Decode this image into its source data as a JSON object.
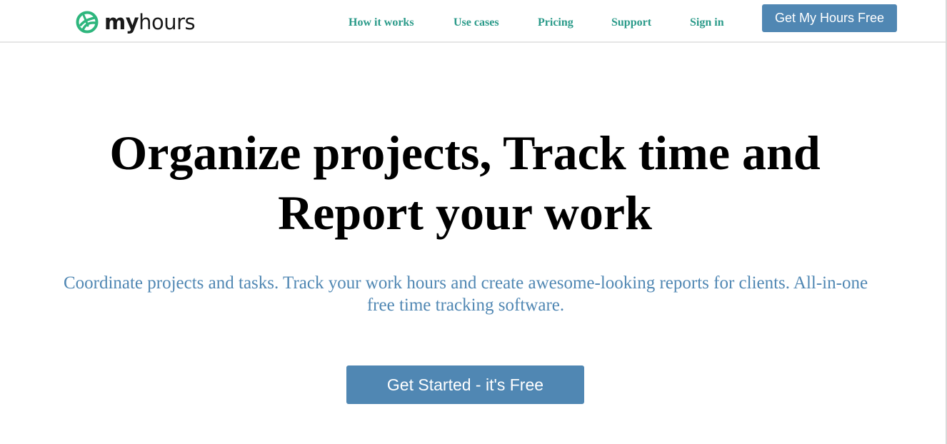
{
  "brand": {
    "name_bold": "my",
    "name_light": "hours",
    "logo_icon": "globe-swirl-icon",
    "accent_color": "#2eb67d"
  },
  "nav": {
    "items": [
      {
        "label": "How it works"
      },
      {
        "label": "Use cases"
      },
      {
        "label": "Pricing"
      },
      {
        "label": "Support"
      },
      {
        "label": "Sign in"
      }
    ],
    "link_color": "#2a9a89",
    "cta_label": "Get My Hours Free"
  },
  "hero": {
    "title_line1": "Organize projects, Track time and",
    "title_line2": "Report your work",
    "subtitle": "Coordinate projects and tasks. Track your work hours and create awesome-looking reports for clients. All-in-one free time tracking software.",
    "cta_label": "Get Started - it's Free"
  },
  "colors": {
    "button_bg": "#5087b3",
    "subtitle_color": "#5087b3"
  }
}
